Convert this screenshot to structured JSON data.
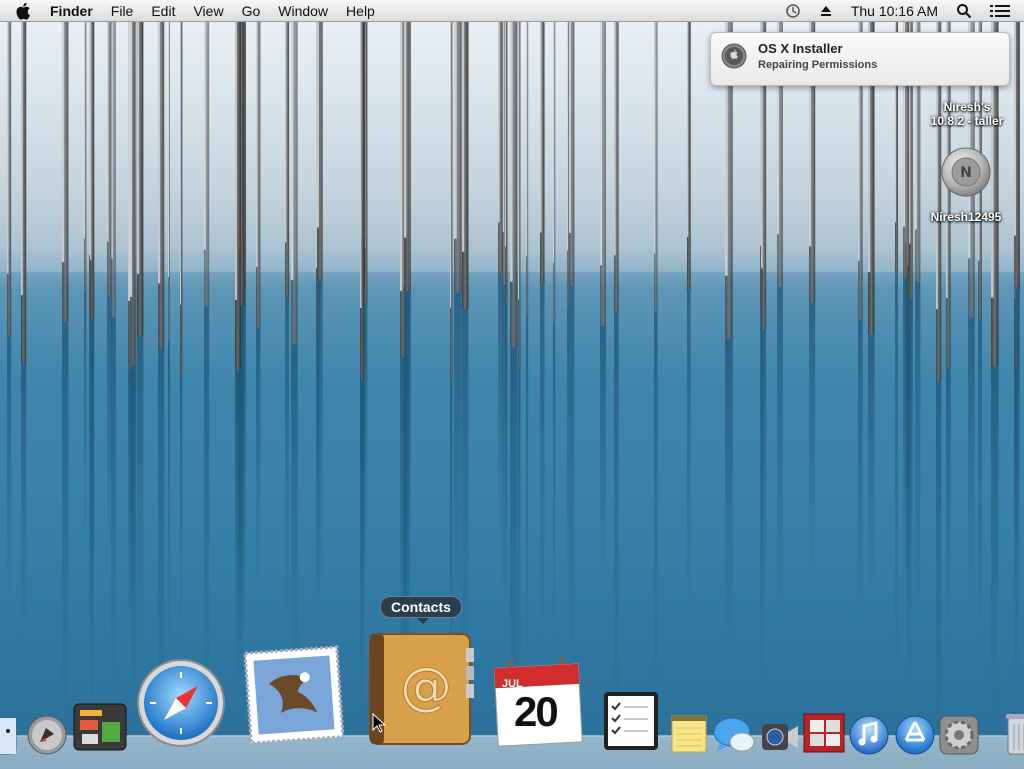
{
  "menubar": {
    "app_name": "Finder",
    "menus": [
      "File",
      "Edit",
      "View",
      "Go",
      "Window",
      "Help"
    ],
    "clock": "Thu 10:16 AM"
  },
  "notification": {
    "title": "OS X Installer",
    "body": "Repairing Permissions"
  },
  "desktop_icons": [
    {
      "label_line1": "Niresh's",
      "label_line2": "10.8.2 - taller"
    },
    {
      "label": "Niresh12495"
    }
  ],
  "dock": {
    "tooltip": "Contacts",
    "calendar_month": "JUL",
    "calendar_day": "20",
    "items": [
      "finder",
      "launchpad",
      "dashboard",
      "safari",
      "mail",
      "contacts",
      "calendar",
      "reminders",
      "notes",
      "messages",
      "facetime",
      "photo-booth",
      "itunes",
      "app-store",
      "system-preferences",
      "trash"
    ]
  },
  "colors": {
    "menubar_top": "#f7f7f7",
    "water": "#3a82aa",
    "snow": "#e4ecf2"
  }
}
